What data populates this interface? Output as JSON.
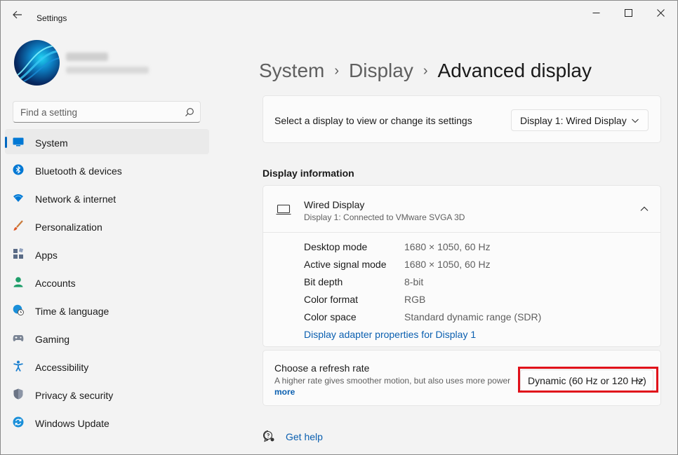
{
  "titlebar": {
    "app_title": "Settings",
    "back_icon": "arrow-left-icon",
    "minimize_icon": "minimize-icon",
    "maximize_icon": "maximize-icon",
    "close_icon": "close-icon"
  },
  "search": {
    "placeholder": "Find a setting",
    "icon": "search-icon"
  },
  "nav": {
    "items": [
      {
        "label": "System",
        "icon": "monitor-icon",
        "active": true
      },
      {
        "label": "Bluetooth & devices",
        "icon": "bluetooth-icon"
      },
      {
        "label": "Network & internet",
        "icon": "wifi-icon"
      },
      {
        "label": "Personalization",
        "icon": "brush-icon"
      },
      {
        "label": "Apps",
        "icon": "apps-icon"
      },
      {
        "label": "Accounts",
        "icon": "person-icon"
      },
      {
        "label": "Time & language",
        "icon": "globe-clock-icon"
      },
      {
        "label": "Gaming",
        "icon": "gamepad-icon"
      },
      {
        "label": "Accessibility",
        "icon": "accessibility-icon"
      },
      {
        "label": "Privacy & security",
        "icon": "shield-icon"
      },
      {
        "label": "Windows Update",
        "icon": "update-icon"
      }
    ]
  },
  "breadcrumb": {
    "items": [
      "System",
      "Display"
    ],
    "current": "Advanced display"
  },
  "select_display": {
    "label": "Select a display to view or change its settings",
    "value": "Display 1: Wired Display"
  },
  "display_info": {
    "section_title": "Display information",
    "name": "Wired Display",
    "subtitle": "Display 1: Connected to VMware SVGA 3D",
    "rows": [
      {
        "key": "Desktop mode",
        "value": "1680 × 1050, 60 Hz"
      },
      {
        "key": "Active signal mode",
        "value": "1680 × 1050, 60 Hz"
      },
      {
        "key": "Bit depth",
        "value": "8-bit"
      },
      {
        "key": "Color format",
        "value": "RGB"
      },
      {
        "key": "Color space",
        "value": "Standard dynamic range (SDR)"
      }
    ],
    "adapter_link": "Display adapter properties for Display 1"
  },
  "refresh_rate": {
    "title": "Choose a refresh rate",
    "description": "A higher rate gives smoother motion, but also uses more power",
    "more": "more",
    "value": "Dynamic (60 Hz or 120 Hz)"
  },
  "help": {
    "label": "Get help"
  },
  "colors": {
    "accent": "#0067c0",
    "link": "#0a5fb0",
    "highlight": "#e0101a"
  }
}
